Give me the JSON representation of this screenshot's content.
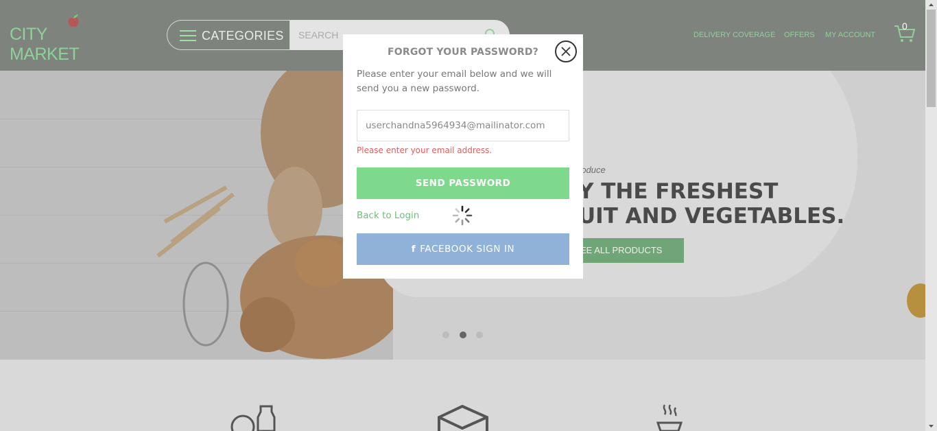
{
  "header": {
    "logo_text": "CITY MARKET",
    "categories_label": "CATEGORIES",
    "search_placeholder": "SEARCH",
    "nav": [
      "DELIVERY COVERAGE",
      "OFFERS",
      "MY ACCOUNT"
    ],
    "cart_count": "0"
  },
  "hero": {
    "eyebrow": "roduce",
    "title_line1": "Y THE FRESHEST",
    "title_line2": "UIT AND VEGETABLES.",
    "button_label": "EE ALL PRODUCTS",
    "slides": 3,
    "active_slide": 2
  },
  "modal": {
    "title": "FORGOT YOUR PASSWORD?",
    "description": "Please enter your email below and we will send you a new password.",
    "email_value": "userchandna5964934@mailinator.com",
    "error": "Please enter your email address.",
    "send_label": "SEND PASSWORD",
    "back_label": "Back to Login",
    "facebook_label": "FACEBOOK SIGN IN",
    "facebook_icon": "f"
  },
  "colors": {
    "header_bg": "#7e837e",
    "accent_green": "#7fd98c",
    "link_green": "#6cc17a",
    "error_red": "#e45c5c",
    "facebook_blue": "#90b2d8"
  },
  "icons": [
    "apple-logo-icon",
    "hamburger-icon",
    "search-icon",
    "cart-icon",
    "close-icon",
    "loading-spinner-icon",
    "facebook-icon",
    "tomato-bottle-icon",
    "box-icon",
    "hot-food-icon"
  ]
}
